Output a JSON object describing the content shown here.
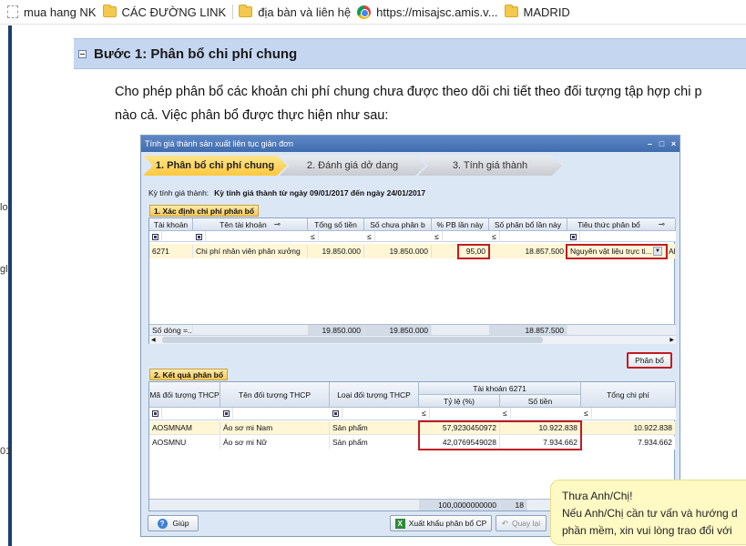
{
  "bookmarks": [
    {
      "label": "mua hang NK",
      "icon": "page-icon"
    },
    {
      "label": "CÁC ĐƯỜNG LINK",
      "icon": "folder-icon"
    },
    {
      "label": "địa bàn và liên hệ",
      "icon": "folder-icon"
    },
    {
      "label": "https://misajsc.amis.v...",
      "icon": "chrome-icon"
    },
    {
      "label": "MADRID",
      "icon": "folder-icon"
    }
  ],
  "edge_text": [
    "lo",
    "gl",
    "01"
  ],
  "section": {
    "title": "Bước 1: Phân bổ chi phí chung"
  },
  "intro": {
    "line1": "Cho phép phân bổ các khoản chi phí chung chưa được theo dõi chi tiết theo đối tượng tập hợp chi p",
    "line2": "nào cả. Việc phân bổ được thực hiện như sau:"
  },
  "window": {
    "title": "Tính giá thành sản xuất liên tục giản đơn",
    "steps": [
      "1. Phân bổ chi phí chung",
      "2. Đánh giá dở dang",
      "3. Tính giá thành"
    ],
    "period_label": "Kỳ tính giá thành:",
    "period_value": "Kỳ tính giá thành từ ngày 09/01/2017 đến ngày 24/01/2017",
    "grid1": {
      "label": "1. Xác định chi phí phân bổ",
      "headers": [
        "Tài khoản",
        "Tên tài khoản",
        "Tổng số tiền",
        "Số chưa phân b",
        "% PB lần này",
        "Số phân bổ lần này",
        "Tiêu thức phân bổ"
      ],
      "filter_ops": [
        "",
        "",
        "≤",
        "≤",
        "≤",
        "≤",
        ""
      ],
      "row": {
        "account": "6271",
        "name": "Chi phí nhân viên phân xưởng",
        "total": "19.850.000",
        "unallocated": "19.850.000",
        "percent": "95,00",
        "allocated": "18.857.500",
        "basis": "Nguyên vật liệu trực ti...",
        "extra": "Al"
      },
      "footer": {
        "label": "Số dòng =...",
        "total": "19.850.000",
        "unallocated": "19.850.000",
        "allocated": "18.857.500"
      }
    },
    "allocate_button": "Phân bổ",
    "grid2": {
      "label": "2. Kết quả phân bổ",
      "headers": {
        "code": "Mã đối tượng THCP",
        "name": "Tên đối tượng THCP",
        "type": "Loại đối tượng THCP",
        "group": "Tài khoản 6271",
        "ratio": "Tỷ lệ (%)",
        "amount": "Số tiền",
        "total": "Tổng chi phí"
      },
      "filter_ops": [
        "≤",
        "≤",
        "≤"
      ],
      "rows": [
        {
          "code": "AOSMNAM",
          "name": "Áo sơ mi Nam",
          "type": "Sản phẩm",
          "ratio": "57,9230450972",
          "amount": "10.922.838",
          "total": "10.922.838"
        },
        {
          "code": "AOSMNU",
          "name": "Áo sơ mi Nữ",
          "type": "Sản phẩm",
          "ratio": "42,0769549028",
          "amount": "7.934.662",
          "total": "7.934.662"
        }
      ],
      "footer": {
        "ratio": "100,0000000000",
        "amount": "18"
      }
    },
    "buttons": {
      "help": "Giúp",
      "export": "Xuất khẩu phân bổ CP",
      "back": "Quay lại"
    }
  },
  "tooltip": {
    "line1": "Thưa Anh/Chị!",
    "line2": "Nếu Anh/Chị cần tư vấn và hướng d",
    "line3": "phần mềm, xin vui lòng trao đổi với"
  },
  "colors": {
    "highlight": "#c11b22",
    "step_active": "#ffd24a",
    "header_band": "#c4d6f0"
  }
}
